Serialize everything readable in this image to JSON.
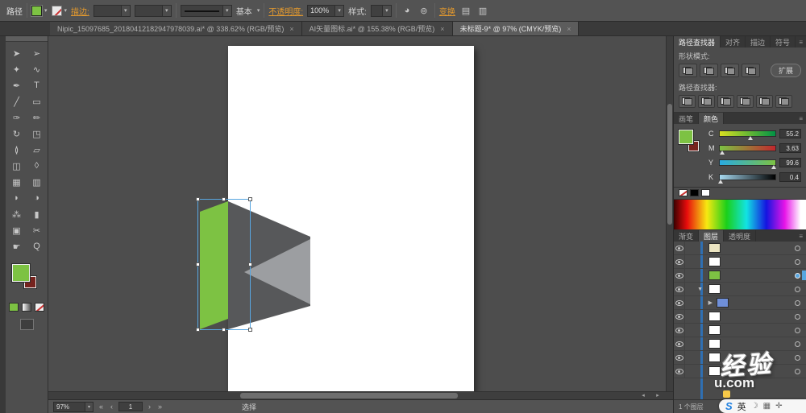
{
  "colors": {
    "accent_orange": "#e59a2e",
    "selection_blue": "#58a6e0",
    "object_green": "#7dc243",
    "object_dark": "#57585a",
    "object_light": "#9c9ea1",
    "layer_blue": "#2f6fb2"
  },
  "top_bar": {
    "mode_label": "路径",
    "stroke_label": "描边:",
    "brush_value": "基本",
    "opacity_label": "不透明度:",
    "opacity_value": "100%",
    "style_label": "样式:",
    "transform_label": "变换"
  },
  "doc_tabs": [
    {
      "title": "Nipic_15097685_20180412182947978039.ai* @ 338.62% (RGB/预览)",
      "close": "×"
    },
    {
      "title": "AI矢量图标.ai* @ 155.38% (RGB/预览)",
      "close": "×"
    },
    {
      "title": "未标题-9* @ 97% (CMYK/预览)",
      "close": "×"
    }
  ],
  "tools": [
    {
      "name": "selection-tool",
      "glyph": "➤"
    },
    {
      "name": "direct-selection-tool",
      "glyph": "➢"
    },
    {
      "name": "magic-wand-tool",
      "glyph": "✦"
    },
    {
      "name": "lasso-tool",
      "glyph": "∿"
    },
    {
      "name": "pen-tool",
      "glyph": "✒"
    },
    {
      "name": "type-tool",
      "glyph": "T"
    },
    {
      "name": "line-segment-tool",
      "glyph": "╱"
    },
    {
      "name": "rectangle-tool",
      "glyph": "▭"
    },
    {
      "name": "paintbrush-tool",
      "glyph": "✑"
    },
    {
      "name": "pencil-tool",
      "glyph": "✏"
    },
    {
      "name": "rotate-tool",
      "glyph": "↻"
    },
    {
      "name": "scale-tool",
      "glyph": "◳"
    },
    {
      "name": "width-tool",
      "glyph": "≬"
    },
    {
      "name": "free-transform-tool",
      "glyph": "▱"
    },
    {
      "name": "shape-builder-tool",
      "glyph": "◫"
    },
    {
      "name": "perspective-grid-tool",
      "glyph": "◊"
    },
    {
      "name": "mesh-tool",
      "glyph": "▦"
    },
    {
      "name": "gradient-tool",
      "glyph": "▥"
    },
    {
      "name": "eyedropper-tool",
      "glyph": "◗"
    },
    {
      "name": "blend-tool",
      "glyph": "◑"
    },
    {
      "name": "symbol-sprayer-tool",
      "glyph": "⁂"
    },
    {
      "name": "column-graph-tool",
      "glyph": "▮"
    },
    {
      "name": "artboard-tool",
      "glyph": "▣"
    },
    {
      "name": "slice-tool",
      "glyph": "✂"
    },
    {
      "name": "hand-tool",
      "glyph": "☛"
    },
    {
      "name": "zoom-tool",
      "glyph": "Q"
    }
  ],
  "panels": {
    "pathfinder": {
      "tabs": [
        "路径查找器",
        "对齐",
        "描边",
        "符号"
      ],
      "shape_modes_label": "形状模式:",
      "expand_label": "扩展",
      "pathfinders_label": "路径查找器:"
    },
    "color": {
      "tabs": [
        "画笔",
        "颜色"
      ],
      "channels": [
        {
          "label": "C",
          "value": "55.2"
        },
        {
          "label": "M",
          "value": "3.63"
        },
        {
          "label": "Y",
          "value": "99.6"
        },
        {
          "label": "K",
          "value": "0.4"
        }
      ]
    },
    "layers": {
      "tabs": [
        "渐变",
        "图层",
        "透明度"
      ],
      "rows": [
        {
          "thumb": "#ece5c2"
        },
        {
          "thumb": "#ffffff"
        },
        {
          "thumb": "#7dc243"
        },
        {
          "thumb": "#ffffff"
        },
        {
          "thumb": "#6f8fd8"
        },
        {
          "thumb": "#ffffff"
        },
        {
          "thumb": "#ffffff"
        },
        {
          "thumb": "#ffffff"
        },
        {
          "thumb": "#ffffff"
        },
        {
          "thumb": "#ffffff"
        }
      ],
      "footer": "1 个图层"
    }
  },
  "status_bar": {
    "zoom": "97%",
    "artboard": "1",
    "status": "选择"
  },
  "watermark": {
    "line1": "经验",
    "line2": "u.com"
  },
  "ime": {
    "logo": "S",
    "lang": "英"
  }
}
